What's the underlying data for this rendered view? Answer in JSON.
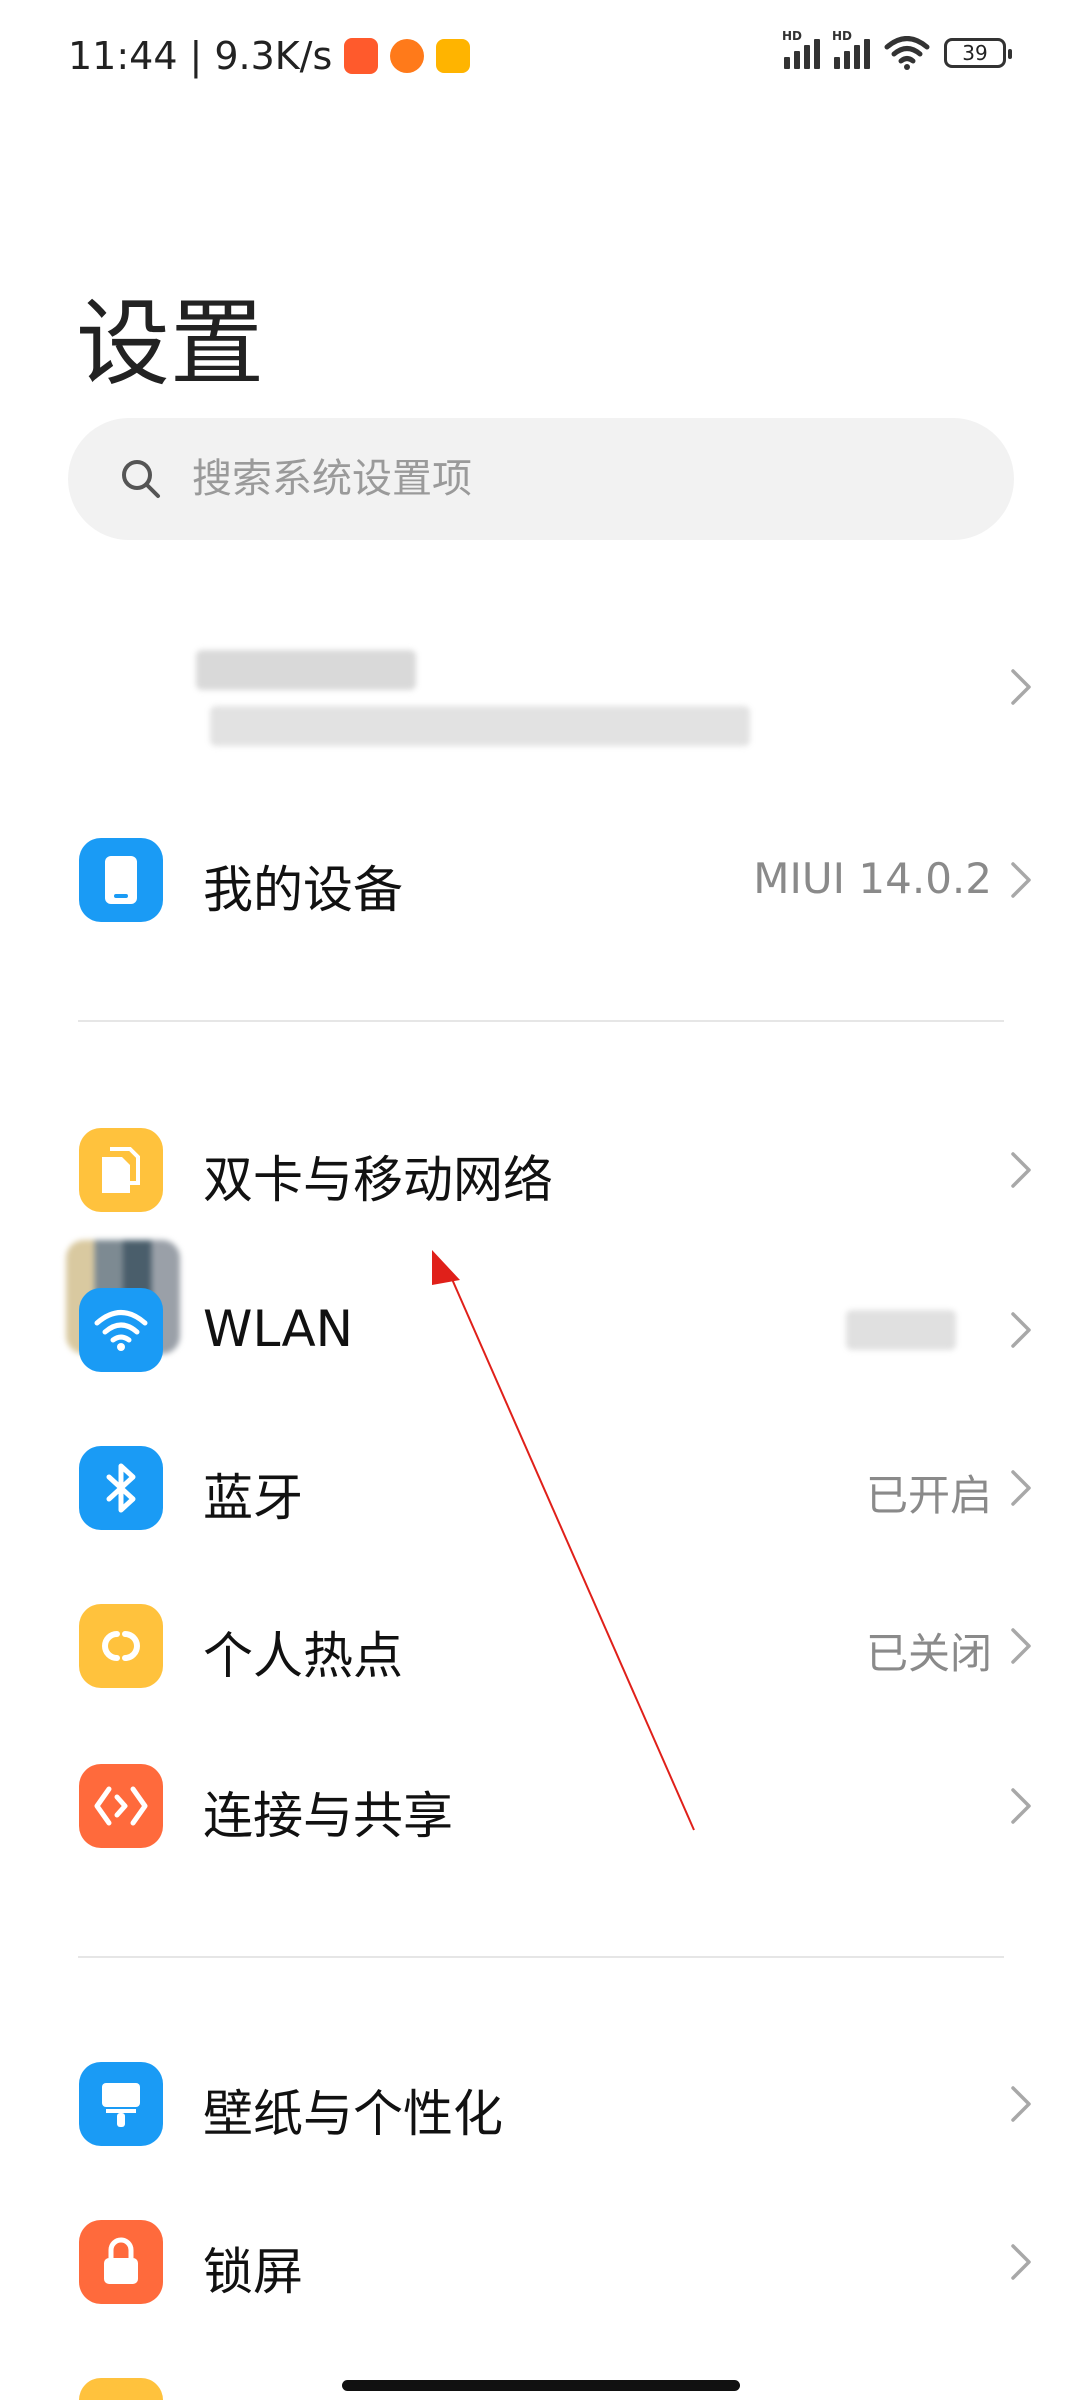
{
  "status_bar": {
    "time": "11:44",
    "separator": "|",
    "net_speed": "9.3K/s",
    "hd1": "HD",
    "hd2": "HD",
    "battery": "39"
  },
  "page": {
    "title": "设置"
  },
  "search": {
    "placeholder": "搜索系统设置项"
  },
  "device": {
    "label": "我的设备",
    "value": "MIUI 14.0.2"
  },
  "network_section": [
    {
      "label": "双卡与移动网络",
      "value": ""
    },
    {
      "label": "WLAN",
      "value": ""
    },
    {
      "label": "蓝牙",
      "value": "已开启"
    },
    {
      "label": "个人热点",
      "value": "已关闭"
    },
    {
      "label": "连接与共享",
      "value": ""
    }
  ],
  "personal_section": [
    {
      "label": "壁纸与个性化",
      "value": ""
    },
    {
      "label": "锁屏",
      "value": ""
    }
  ],
  "colors": {
    "blue": "#1a9bf5",
    "yellow": "#ffc23d",
    "orange": "#ff6a3c",
    "arrow": "#e0201a"
  }
}
